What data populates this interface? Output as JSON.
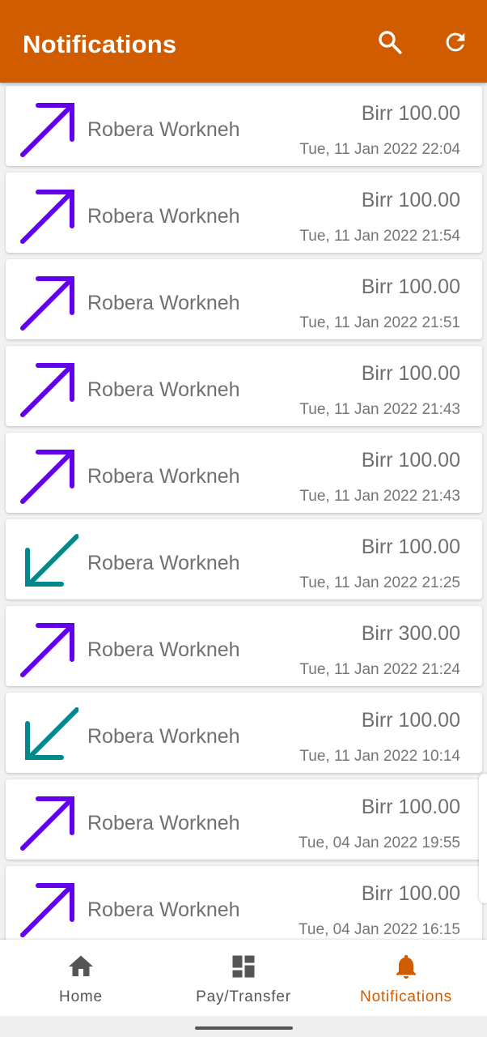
{
  "appbar": {
    "title": "Notifications",
    "search_icon": "search-icon",
    "refresh_icon": "refresh-icon",
    "background_color": "#d15c00"
  },
  "colors": {
    "outgoing_arrow": "#6200ee",
    "incoming_arrow": "#00888a",
    "active_nav": "#d15c00",
    "inactive_nav": "#555555"
  },
  "notifications": [
    {
      "direction": "outgoing",
      "name": "Robera Workneh",
      "amount": "Birr 100.00",
      "date": "Tue, 11 Jan 2022 22:04"
    },
    {
      "direction": "outgoing",
      "name": "Robera Workneh",
      "amount": "Birr 100.00",
      "date": "Tue, 11 Jan 2022 21:54"
    },
    {
      "direction": "outgoing",
      "name": "Robera Workneh",
      "amount": "Birr 100.00",
      "date": "Tue, 11 Jan 2022 21:51"
    },
    {
      "direction": "outgoing",
      "name": "Robera Workneh",
      "amount": "Birr 100.00",
      "date": "Tue, 11 Jan 2022 21:43"
    },
    {
      "direction": "outgoing",
      "name": "Robera Workneh",
      "amount": "Birr 100.00",
      "date": "Tue, 11 Jan 2022 21:43"
    },
    {
      "direction": "incoming",
      "name": "Robera Workneh",
      "amount": "Birr 100.00",
      "date": "Tue, 11 Jan 2022 21:25"
    },
    {
      "direction": "outgoing",
      "name": "Robera Workneh",
      "amount": "Birr 300.00",
      "date": "Tue, 11 Jan 2022 21:24"
    },
    {
      "direction": "incoming",
      "name": "Robera Workneh",
      "amount": "Birr 100.00",
      "date": "Tue, 11 Jan 2022 10:14"
    },
    {
      "direction": "outgoing",
      "name": "Robera Workneh",
      "amount": "Birr 100.00",
      "date": "Tue, 04 Jan 2022 19:55"
    },
    {
      "direction": "outgoing",
      "name": "Robera Workneh",
      "amount": "Birr 100.00",
      "date": "Tue, 04 Jan 2022 16:15"
    }
  ],
  "bottom_nav": {
    "home": {
      "label": "Home",
      "icon": "home-icon"
    },
    "pay_transfer": {
      "label": "Pay/Transfer",
      "icon": "dashboard-icon"
    },
    "notifications": {
      "label": "Notifications",
      "icon": "bell-icon",
      "active": true
    }
  }
}
